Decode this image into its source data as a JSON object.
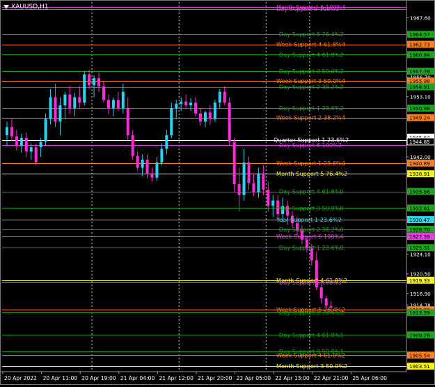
{
  "chart": {
    "symbol": "XAUUSD,H1",
    "colors": {
      "background": "#000000",
      "bull": "#2ad3f5",
      "bear": "#ff2bd6",
      "grid": "#cfcfcf",
      "day": "#1ea31e",
      "week": "#ff7f1e",
      "month": "#f2f21a",
      "year": "#33d4e6",
      "quarter": "#ffffff",
      "day6": "#e040e0"
    }
  },
  "chart_data": {
    "type": "candlestick",
    "ylim": [
      1902.5,
      1970.5
    ],
    "y_ticks": [
      1967.6,
      1960.84,
      1957.78,
      1956.7,
      1953.1,
      1949.55,
      1945.64,
      1942.0,
      1938.4,
      1934.85,
      1931.25,
      1927.7,
      1924.1,
      1920.5,
      1916.9,
      1914.78,
      1913.39,
      1909.76,
      1906.2,
      1902.6
    ],
    "x_labels": [
      "20 Apr 2022",
      "20 Apr 11:00",
      "20 Apr 19:00",
      "21 Apr 04:00",
      "21 Apr 12:00",
      "21 Apr 20:00",
      "22 Apr 05:00",
      "22 Apr 13:00",
      "22 Apr 21:00",
      "25 Apr 06:00"
    ],
    "x_label_bars": [
      0,
      8,
      16,
      24,
      32,
      40,
      48,
      56,
      64,
      72
    ],
    "period_separators": [
      18,
      36,
      54,
      63
    ],
    "candles": [
      [
        1946.0,
        1948.5,
        1944.0,
        1947.5
      ],
      [
        1947.5,
        1949.0,
        1945.0,
        1945.8
      ],
      [
        1945.8,
        1947.0,
        1943.2,
        1944.0
      ],
      [
        1944.0,
        1946.3,
        1942.8,
        1945.5
      ],
      [
        1945.5,
        1946.5,
        1942.0,
        1943.0
      ],
      [
        1943.0,
        1944.5,
        1941.5,
        1943.8
      ],
      [
        1943.8,
        1944.4,
        1940.5,
        1941.0
      ],
      [
        1943.8,
        1945.5,
        1942.0,
        1944.8
      ],
      [
        1944.8,
        1950.0,
        1944.0,
        1949.0
      ],
      [
        1949.0,
        1954.5,
        1948.0,
        1953.0
      ],
      [
        1953.0,
        1955.5,
        1947.5,
        1948.5
      ],
      [
        1948.5,
        1953.0,
        1946.0,
        1951.5
      ],
      [
        1951.5,
        1954.0,
        1949.0,
        1953.5
      ],
      [
        1953.5,
        1955.0,
        1950.0,
        1951.0
      ],
      [
        1951.0,
        1953.8,
        1949.5,
        1953.0
      ],
      [
        1953.0,
        1955.0,
        1951.0,
        1952.0
      ],
      [
        1952.0,
        1957.8,
        1951.5,
        1957.2
      ],
      [
        1957.2,
        1958.0,
        1954.5,
        1955.2
      ],
      [
        1955.2,
        1957.0,
        1953.0,
        1956.5
      ],
      [
        1956.5,
        1957.5,
        1954.0,
        1955.0
      ],
      [
        1955.0,
        1956.0,
        1952.0,
        1952.5
      ],
      [
        1952.5,
        1953.5,
        1949.8,
        1951.0
      ],
      [
        1951.0,
        1953.0,
        1949.5,
        1952.5
      ],
      [
        1952.5,
        1954.0,
        1950.5,
        1951.0
      ],
      [
        1951.0,
        1955.5,
        1950.0,
        1954.0
      ],
      [
        1951.0,
        1953.0,
        1945.0,
        1946.0
      ],
      [
        1946.0,
        1947.0,
        1941.5,
        1942.2
      ],
      [
        1942.2,
        1943.0,
        1939.5,
        1940.0
      ],
      [
        1940.0,
        1942.5,
        1938.5,
        1941.5
      ],
      [
        1941.5,
        1942.5,
        1938.0,
        1939.0
      ],
      [
        1939.0,
        1940.0,
        1937.5,
        1938.2
      ],
      [
        1938.2,
        1942.0,
        1937.6,
        1941.0
      ],
      [
        1941.0,
        1944.5,
        1940.5,
        1943.5
      ],
      [
        1943.5,
        1947.0,
        1942.5,
        1946.0
      ],
      [
        1946.0,
        1952.0,
        1945.5,
        1951.0
      ],
      [
        1951.0,
        1952.5,
        1949.0,
        1951.8
      ],
      [
        1951.8,
        1953.0,
        1950.5,
        1952.2
      ],
      [
        1952.2,
        1953.5,
        1951.0,
        1951.5
      ],
      [
        1951.5,
        1952.8,
        1950.5,
        1952.0
      ],
      [
        1952.0,
        1953.0,
        1949.5,
        1950.0
      ],
      [
        1950.0,
        1951.0,
        1947.8,
        1948.5
      ],
      [
        1948.5,
        1950.5,
        1947.5,
        1950.2
      ],
      [
        1950.2,
        1951.5,
        1948.0,
        1949.0
      ],
      [
        1949.0,
        1952.5,
        1948.5,
        1952.0
      ],
      [
        1952.0,
        1954.5,
        1951.0,
        1954.0
      ],
      [
        1954.0,
        1955.0,
        1951.5,
        1952.0
      ],
      [
        1952.0,
        1953.0,
        1944.0,
        1944.8
      ],
      [
        1944.8,
        1945.5,
        1935.5,
        1937.0
      ],
      [
        1937.0,
        1940.0,
        1932.0,
        1935.0
      ],
      [
        1935.0,
        1943.5,
        1934.0,
        1941.0
      ],
      [
        1941.0,
        1942.0,
        1936.0,
        1937.2
      ],
      [
        1937.2,
        1939.0,
        1934.8,
        1935.5
      ],
      [
        1935.5,
        1940.0,
        1934.5,
        1939.0
      ],
      [
        1939.0,
        1940.5,
        1935.0,
        1936.0
      ],
      [
        1936.0,
        1937.5,
        1932.0,
        1933.0
      ],
      [
        1933.0,
        1935.0,
        1931.0,
        1934.0
      ],
      [
        1934.0,
        1935.0,
        1930.5,
        1931.5
      ],
      [
        1931.5,
        1934.5,
        1930.0,
        1933.0
      ],
      [
        1933.0,
        1934.0,
        1929.5,
        1931.2
      ],
      [
        1931.2,
        1932.0,
        1929.0,
        1929.8
      ],
      [
        1929.8,
        1931.0,
        1927.5,
        1928.5
      ],
      [
        1928.5,
        1929.5,
        1926.0,
        1926.8
      ],
      [
        1926.8,
        1927.5,
        1924.5,
        1925.2
      ],
      [
        1925.2,
        1926.0,
        1922.0,
        1923.0
      ],
      [
        1923.0,
        1924.5,
        1917.5,
        1918.0
      ],
      [
        1918.0,
        1919.0,
        1915.0,
        1916.0
      ],
      [
        1916.0,
        1916.5,
        1913.8,
        1914.6
      ],
      [
        1914.6,
        1915.5,
        1913.4,
        1914.3
      ]
    ]
  },
  "price_labels": [
    {
      "price": 1967.6,
      "text": "1967.60",
      "kind": "tick"
    },
    {
      "price": 1964.57,
      "text": "1964.57",
      "kind": "day"
    },
    {
      "price": 1962.73,
      "text": "1962.73",
      "kind": "week"
    },
    {
      "price": 1960.84,
      "text": "1960.84",
      "kind": "day"
    },
    {
      "price": 1957.78,
      "text": "1957.78",
      "kind": "day"
    },
    {
      "price": 1956.7,
      "text": "1956.70",
      "kind": "tick"
    },
    {
      "price": 1955.98,
      "text": "1955.98",
      "kind": "week"
    },
    {
      "price": 1954.91,
      "text": "1954.91",
      "kind": "day"
    },
    {
      "price": 1953.1,
      "text": "1953.10",
      "kind": "tick"
    },
    {
      "price": 1950.98,
      "text": "1950.98",
      "kind": "day"
    },
    {
      "price": 1949.24,
      "text": "1949.24",
      "kind": "week"
    },
    {
      "price": 1945.64,
      "text": "1945.64",
      "kind": "current"
    },
    {
      "price": 1944.85,
      "text": "1944.85",
      "kind": "quarter"
    },
    {
      "price": 1942.0,
      "text": "1942.00",
      "kind": "tick"
    },
    {
      "price": 1940.89,
      "text": "1940.89",
      "kind": "week"
    },
    {
      "price": 1938.91,
      "text": "1938.91",
      "kind": "month"
    },
    {
      "price": 1935.66,
      "text": "1935.66",
      "kind": "day"
    },
    {
      "price": 1932.61,
      "text": "1932.61",
      "kind": "day"
    },
    {
      "price": 1930.47,
      "text": "1930.47",
      "kind": "year"
    },
    {
      "price": 1928.7,
      "text": "1928.70",
      "kind": "day"
    },
    {
      "price": 1927.39,
      "text": "1927.39",
      "kind": "day6"
    },
    {
      "price": 1925.31,
      "text": "1925.31",
      "kind": "day"
    },
    {
      "price": 1924.1,
      "text": "1924.10",
      "kind": "tick"
    },
    {
      "price": 1920.5,
      "text": "1920.50",
      "kind": "tick"
    },
    {
      "price": 1919.33,
      "text": "1919.33",
      "kind": "month"
    },
    {
      "price": 1916.9,
      "text": "1916.90",
      "kind": "tick"
    },
    {
      "price": 1914.78,
      "text": "1914.78",
      "kind": "tick"
    },
    {
      "price": 1913.89,
      "text": "1913.89",
      "kind": "week"
    },
    {
      "price": 1913.39,
      "text": "1913.39",
      "kind": "day"
    },
    {
      "price": 1909.26,
      "text": "1909.26",
      "kind": "day"
    },
    {
      "price": 1905.54,
      "text": "1905.54",
      "kind": "week"
    },
    {
      "price": 1903.51,
      "text": "1903.51",
      "kind": "month"
    }
  ],
  "levels": [
    {
      "price": 1969.6,
      "label": "Month Support 6 100%4",
      "kind": "day6",
      "lx": 396
    },
    {
      "price": 1969.2,
      "label": "Day Support 6 100%1",
      "kind": "day6",
      "lx": 396
    },
    {
      "price": 1964.57,
      "label": "Day Support 5 76.4%2",
      "kind": "day",
      "lx": 400
    },
    {
      "price": 1962.73,
      "label": "Week Support 4 61.8%4",
      "kind": "week",
      "lx": 396
    },
    {
      "price": 1960.84,
      "label": "Day Support 4 61.8%2",
      "kind": "day",
      "lx": 400
    },
    {
      "price": 1957.78,
      "label": "Day Support 3 50.0%2",
      "kind": "day",
      "lx": 400
    },
    {
      "price": 1955.98,
      "label": "Week Support 3 50.0%4",
      "kind": "week",
      "lx": 396
    },
    {
      "price": 1954.91,
      "label": "Day Support 2 38.2%2",
      "kind": "day",
      "lx": 400
    },
    {
      "price": 1950.98,
      "label": "Day Support 1 23.6%2",
      "kind": "day",
      "lx": 400
    },
    {
      "price": 1949.24,
      "label": "Week Support 2 38.2%4",
      "kind": "week",
      "lx": 396
    },
    {
      "price": 1945.15,
      "label": "Quarter Support 1 23.6%2",
      "kind": "quarter",
      "lx": 392
    },
    {
      "price": 1944.2,
      "label": "Day Support 6 100%2",
      "kind": "day6",
      "lx": 400
    },
    {
      "price": 1940.89,
      "label": "Week Support 1 23.6%4",
      "kind": "week",
      "lx": 396
    },
    {
      "price": 1938.91,
      "label": "Month Support 5 76.4%2",
      "kind": "month",
      "lx": 396
    },
    {
      "price": 1935.66,
      "label": "Day Support 4 61.8%0",
      "kind": "day",
      "lx": 400
    },
    {
      "price": 1932.61,
      "label": "Day Support 3 50.0%0",
      "kind": "day",
      "lx": 400
    },
    {
      "price": 1930.47,
      "label": "Year Support 1 23.6%2",
      "kind": "year",
      "lx": 396
    },
    {
      "price": 1928.7,
      "label": "Day Support 2 38.2%0",
      "kind": "day",
      "lx": 400
    },
    {
      "price": 1927.39,
      "label": "Week Support 6 100%4",
      "kind": "day6",
      "lx": 396
    },
    {
      "price": 1925.31,
      "label": "Day Support 1 23.6%0",
      "kind": "day",
      "lx": 400
    },
    {
      "price": 1919.33,
      "label": "Month Support 4 61.8%2",
      "kind": "month",
      "lx": 396
    },
    {
      "price": 1918.9,
      "label": "Day Support 6 100%1",
      "kind": "day6",
      "lx": 400
    },
    {
      "price": 1913.89,
      "label": "Week Support 5 76.4%2",
      "kind": "week",
      "lx": 396
    },
    {
      "price": 1913.39,
      "label": "Day Support 5 76.4%1",
      "kind": "day",
      "lx": 400
    },
    {
      "price": 1909.26,
      "label": "Day Support 4 61.8%1",
      "kind": "day",
      "lx": 400
    },
    {
      "price": 1906.2,
      "label": "Day Support 3 50.0%1",
      "kind": "day",
      "lx": 400
    },
    {
      "price": 1905.54,
      "label": "Week Support 4 61.8%2",
      "kind": "week",
      "lx": 396
    },
    {
      "price": 1903.51,
      "label": "Month Support 3 50.0%2",
      "kind": "month",
      "lx": 396
    }
  ]
}
